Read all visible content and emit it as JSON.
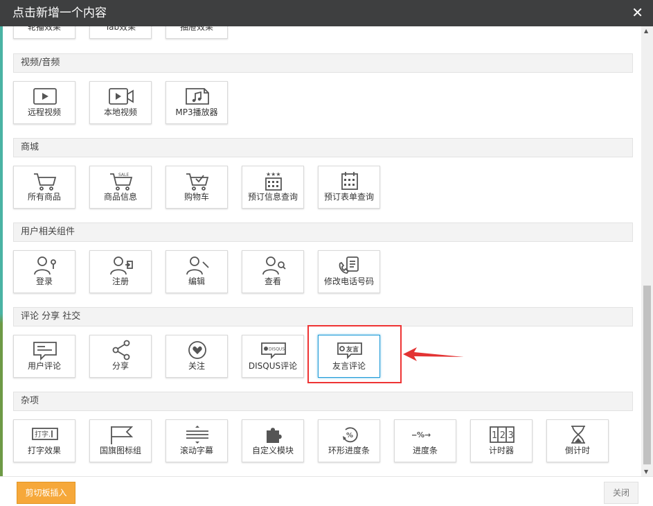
{
  "dialog": {
    "title": "点击新增一个内容",
    "close_symbol": "✕"
  },
  "sections": [
    {
      "title": "",
      "tiles": [
        {
          "label": "轮播效果",
          "icon": "carousel-icon"
        },
        {
          "label": "Tab效果",
          "icon": "tab-icon"
        },
        {
          "label": "抽屉效果",
          "icon": "drawer-icon"
        }
      ]
    },
    {
      "title": "视频/音频",
      "tiles": [
        {
          "label": "远程视频",
          "icon": "remote-video-icon"
        },
        {
          "label": "本地视频",
          "icon": "local-video-icon"
        },
        {
          "label": "MP3播放器",
          "icon": "mp3-player-icon"
        }
      ]
    },
    {
      "title": "商城",
      "tiles": [
        {
          "label": "所有商品",
          "icon": "cart-icon"
        },
        {
          "label": "商品信息",
          "icon": "cart-sale-icon"
        },
        {
          "label": "购物车",
          "icon": "cart-check-icon"
        },
        {
          "label": "预订信息查询",
          "icon": "calendar-stars-icon"
        },
        {
          "label": "预订表单查询",
          "icon": "calendar-grid-icon"
        }
      ]
    },
    {
      "title": "用户相关组件",
      "tiles": [
        {
          "label": "登录",
          "icon": "user-key-icon"
        },
        {
          "label": "注册",
          "icon": "user-register-icon"
        },
        {
          "label": "编辑",
          "icon": "user-edit-icon"
        },
        {
          "label": "查看",
          "icon": "user-search-icon"
        },
        {
          "label": "修改电话号码",
          "icon": "phone-edit-icon"
        }
      ]
    },
    {
      "title": "评论 分享 社交",
      "tiles": [
        {
          "label": "用户评论",
          "icon": "comment-icon"
        },
        {
          "label": "分享",
          "icon": "share-icon"
        },
        {
          "label": "关注",
          "icon": "heart-icon"
        },
        {
          "label": "DISQUS评论",
          "icon": "disqus-icon",
          "icon_text": "DISQUS"
        },
        {
          "label": "友言评论",
          "icon": "youyan-icon",
          "icon_text": "友言",
          "selected": true
        }
      ]
    },
    {
      "title": "杂项",
      "tiles": [
        {
          "label": "打字效果",
          "icon": "typing-icon",
          "icon_text": "打字."
        },
        {
          "label": "国旗图标组",
          "icon": "flag-icon"
        },
        {
          "label": "滚动字幕",
          "icon": "marquee-icon"
        },
        {
          "label": "自定义模块",
          "icon": "puzzle-icon"
        },
        {
          "label": "环形进度条",
          "icon": "ring-progress-icon",
          "icon_text": "%"
        },
        {
          "label": "进度条",
          "icon": "progress-bar-icon",
          "icon_text": "—%→"
        },
        {
          "label": "计时器",
          "icon": "timer-icon",
          "icon_text": "123"
        },
        {
          "label": "倒计时",
          "icon": "hourglass-icon"
        }
      ]
    }
  ],
  "footer": {
    "paste_button": "剪切板插入",
    "close_button": "关闭"
  },
  "colors": {
    "titlebar": "#3e3f40",
    "paste_button": "#f6a83a",
    "highlight": "#e33333",
    "selected_border": "#1e9bd8"
  }
}
